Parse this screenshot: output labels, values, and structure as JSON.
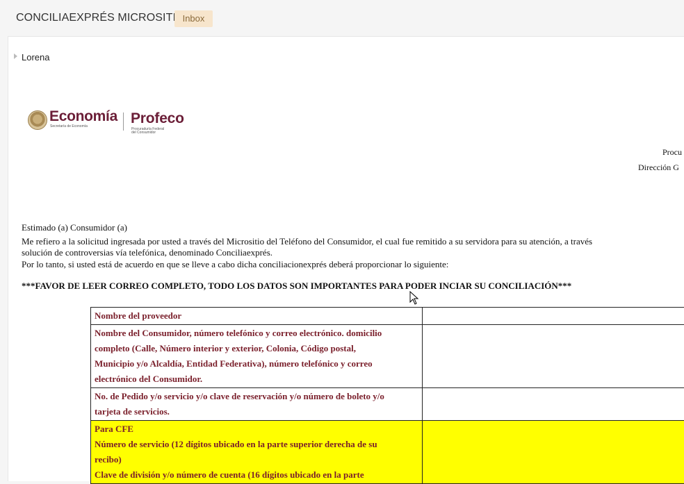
{
  "header": {
    "subject": "CONCILIAEXPRÉS MICROSITIO",
    "tag": "Inbox"
  },
  "message": {
    "sender": "Lorena"
  },
  "logo": {
    "economia": "Economía",
    "economia_sub": "Secretaría de Economía",
    "profeco": "Profeco",
    "profeco_sub1": "Procuraduría Federal",
    "profeco_sub2": "del Consumidor"
  },
  "letterhead": {
    "line1": "Procu",
    "line2": "Dirección G"
  },
  "body": {
    "greeting": "Estimado (a) Consumidor (a)",
    "para1_line1": "Me refiero a la solicitud ingresada por usted a través del Micrositio del Teléfono del Consumidor, el cual fue remitido a su servidora para su atención, a través",
    "para1_line2": "solución de controversias vía telefónica, denominado Conciliaexprés.",
    "para2": "Por lo tanto, si usted está de acuerdo en que se lleve a cabo dicha conciliacionexprés deberá proporcionar lo siguiente:",
    "notice": "***FAVOR DE LEER CORREO COMPLETO, TODO LOS DATOS SON IMPORTANTES PARA PODER INCIAR SU CONCILIACIÓN***"
  },
  "table": {
    "rows": [
      {
        "lines": [
          "Nombre del  proveedor"
        ],
        "highlight": false
      },
      {
        "lines": [
          "Nombre del Consumidor, número telefónico y correo electrónico. domicilio",
          "completo (Calle, Número interior y exterior, Colonia, Código postal,",
          "Municipio y/o Alcaldía, Entidad Federativa), número telefónico y correo",
          "electrónico del Consumidor."
        ],
        "highlight": false
      },
      {
        "lines": [
          "No. de Pedido y/o servicio y/o clave de reservación y/o número de boleto y/o",
          "tarjeta de servicios."
        ],
        "highlight": false
      },
      {
        "lines": [
          "Para CFE",
          "Número de servicio (12 dígitos ubicado en la parte superior derecha de su",
          "recibo)",
          "Clave de división y/o número de cuenta (16 dígitos ubicado en la parte"
        ],
        "highlight": true,
        "highlight_color": "#ffff00"
      }
    ]
  }
}
